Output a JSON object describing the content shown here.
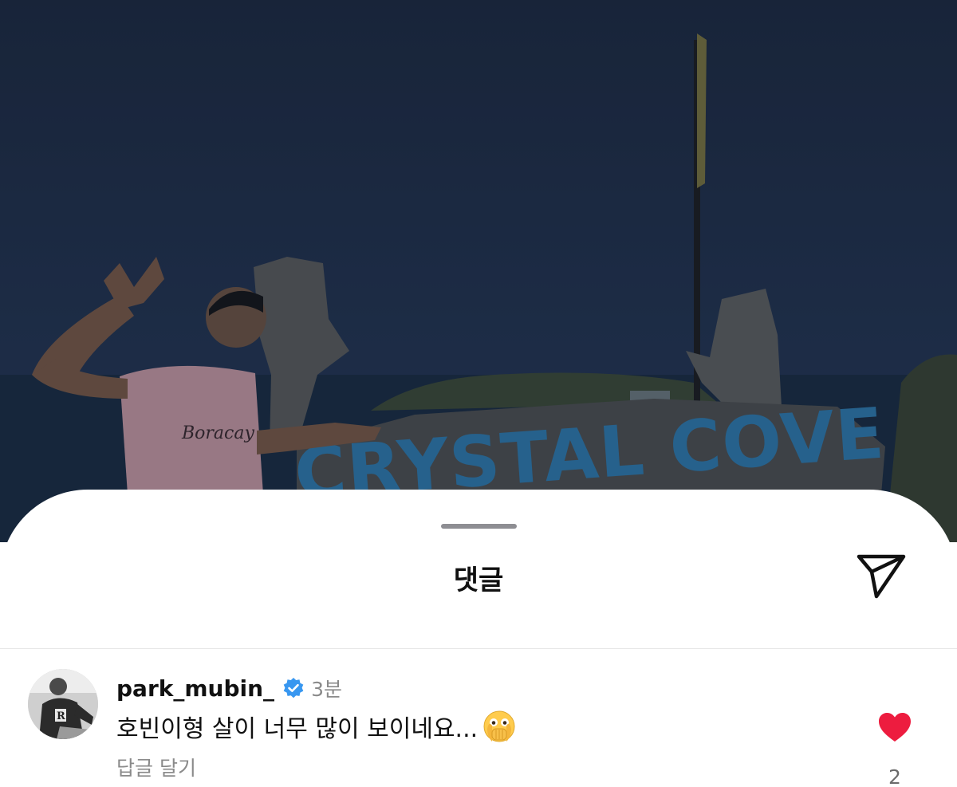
{
  "background_photo": {
    "shirt_text": "Boracay",
    "sign_text": "CRYSTAL COVE"
  },
  "sheet": {
    "title": "댓글",
    "share_icon": "paper-plane-icon"
  },
  "comment": {
    "username": "park_mubin_",
    "verified": true,
    "time": "3분",
    "text": "호빈이형 살이 너무 많이 보이네요...",
    "emoji": "face-with-open-eyes-and-hand-over-mouth",
    "reply_label": "답글 달기",
    "like_count": "2",
    "liked": true
  },
  "colors": {
    "like": "#ed1c3f",
    "verified": "#3897f0",
    "secondary_text": "#8a8a8a"
  }
}
